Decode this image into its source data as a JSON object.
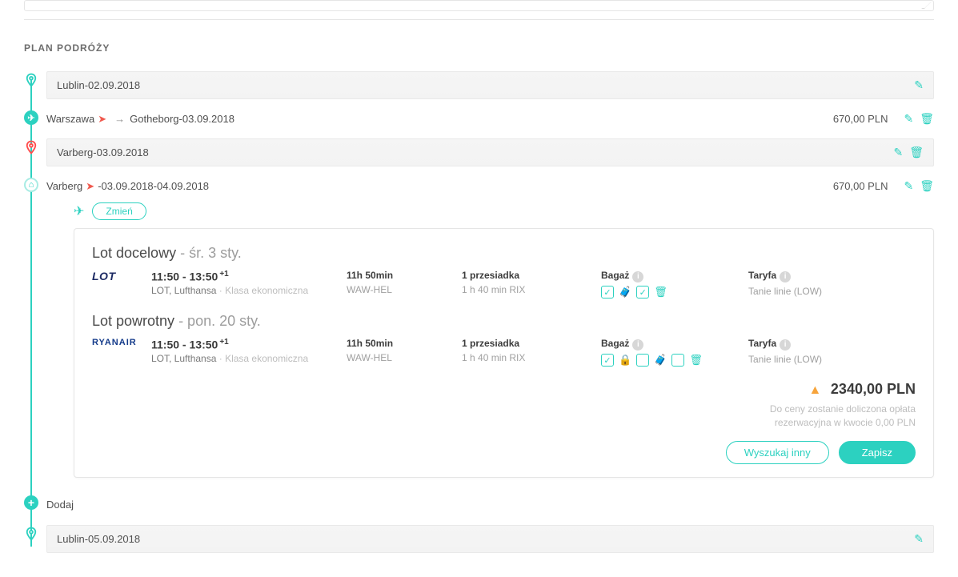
{
  "sectionTitle": "PLAN PODRÓŻY",
  "steps": {
    "s1": {
      "city": "Lublin",
      "sep": " - ",
      "date": "02.09.2018"
    },
    "s2": {
      "from": "Warszawa",
      "arrow": "→",
      "to": "Gotheborg",
      "sep": " - ",
      "date": "03.09.2018",
      "price": "670,00 PLN"
    },
    "s3": {
      "city": "Varberg",
      "sep": " - ",
      "date": "03.09.2018"
    },
    "s4": {
      "city": "Varberg",
      "sep": " - ",
      "date1": "03.09.2018",
      "dash": " - ",
      "date2": "04.09.2018",
      "price": "670,00 PLN",
      "changeLabel": "Zmień"
    },
    "add": {
      "label": "Dodaj"
    },
    "s5": {
      "city": "Lublin",
      "sep": " - ",
      "date": "05.09.2018"
    }
  },
  "flightCard": {
    "outbound": {
      "titleMain": "Lot docelowy",
      "titleSub": " - śr. 3 sty.",
      "airlineLogo": "LOT",
      "timeFrom": "11:50",
      "timeDash": "  -  ",
      "timeTo": "13:50",
      "timeSup": "+1",
      "carriers": "LOT, Lufthansa",
      "dotSep": "  ·  ",
      "classLabel": "Klasa ekonomiczna",
      "duration": "11h 50min",
      "route": "WAW-HEL",
      "stopsLabel": "1 przesiadka",
      "stopsDetail": "1 h  40 min RIX",
      "baggageLabel": "Bagaż",
      "tariffLabel": "Taryfa",
      "tariffValue": "Tanie linie (LOW)"
    },
    "return": {
      "titleMain": "Lot powrotny",
      "titleSub": " - pon. 20 sty.",
      "airlineLogo": "RYANAIR",
      "timeFrom": "11:50",
      "timeDash": "  -  ",
      "timeTo": "13:50",
      "timeSup": "+1",
      "carriers": "LOT, Lufthansa",
      "dotSep": "  ·  ",
      "classLabel": "Klasa ekonomiczna",
      "duration": "11h 50min",
      "route": "WAW-HEL",
      "stopsLabel": "1 przesiadka",
      "stopsDetail": "1 h  40 min RIX",
      "baggageLabel": "Bagaż",
      "tariffLabel": "Taryfa",
      "tariffValue": "Tanie linie (LOW)"
    },
    "totalPrice": "2340,00 PLN",
    "feeNote1": "Do ceny zostanie doliczona opłata",
    "feeNote2": "rezerwacyjna w kwocie 0,00 PLN",
    "searchOther": "Wyszukaj inny",
    "save": "Zapisz"
  }
}
